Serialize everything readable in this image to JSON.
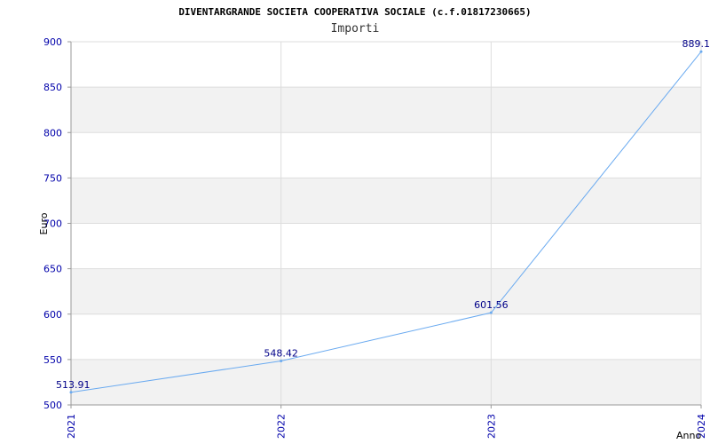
{
  "chart_data": {
    "type": "line",
    "title": "DIVENTARGRANDE SOCIETA COOPERATIVA SOCIALE (c.f.01817230665)",
    "subtitle": "Importi",
    "xlabel": "Anno",
    "ylabel": "Euro",
    "ylim": [
      500,
      900
    ],
    "yticks": [
      500,
      550,
      600,
      650,
      700,
      750,
      800,
      850,
      900
    ],
    "grid": true,
    "x": [
      "2021",
      "2022",
      "2023",
      "2024"
    ],
    "series": [
      {
        "values": [
          513.91,
          548.42,
          601.56,
          889.1
        ],
        "labels": [
          "513.91",
          "548.42",
          "601.56",
          "889.1"
        ]
      }
    ],
    "colors": {
      "line": "#6aaaf0",
      "band": "#f2f2f2",
      "tick": "#0000aa",
      "label": "#000088"
    }
  }
}
